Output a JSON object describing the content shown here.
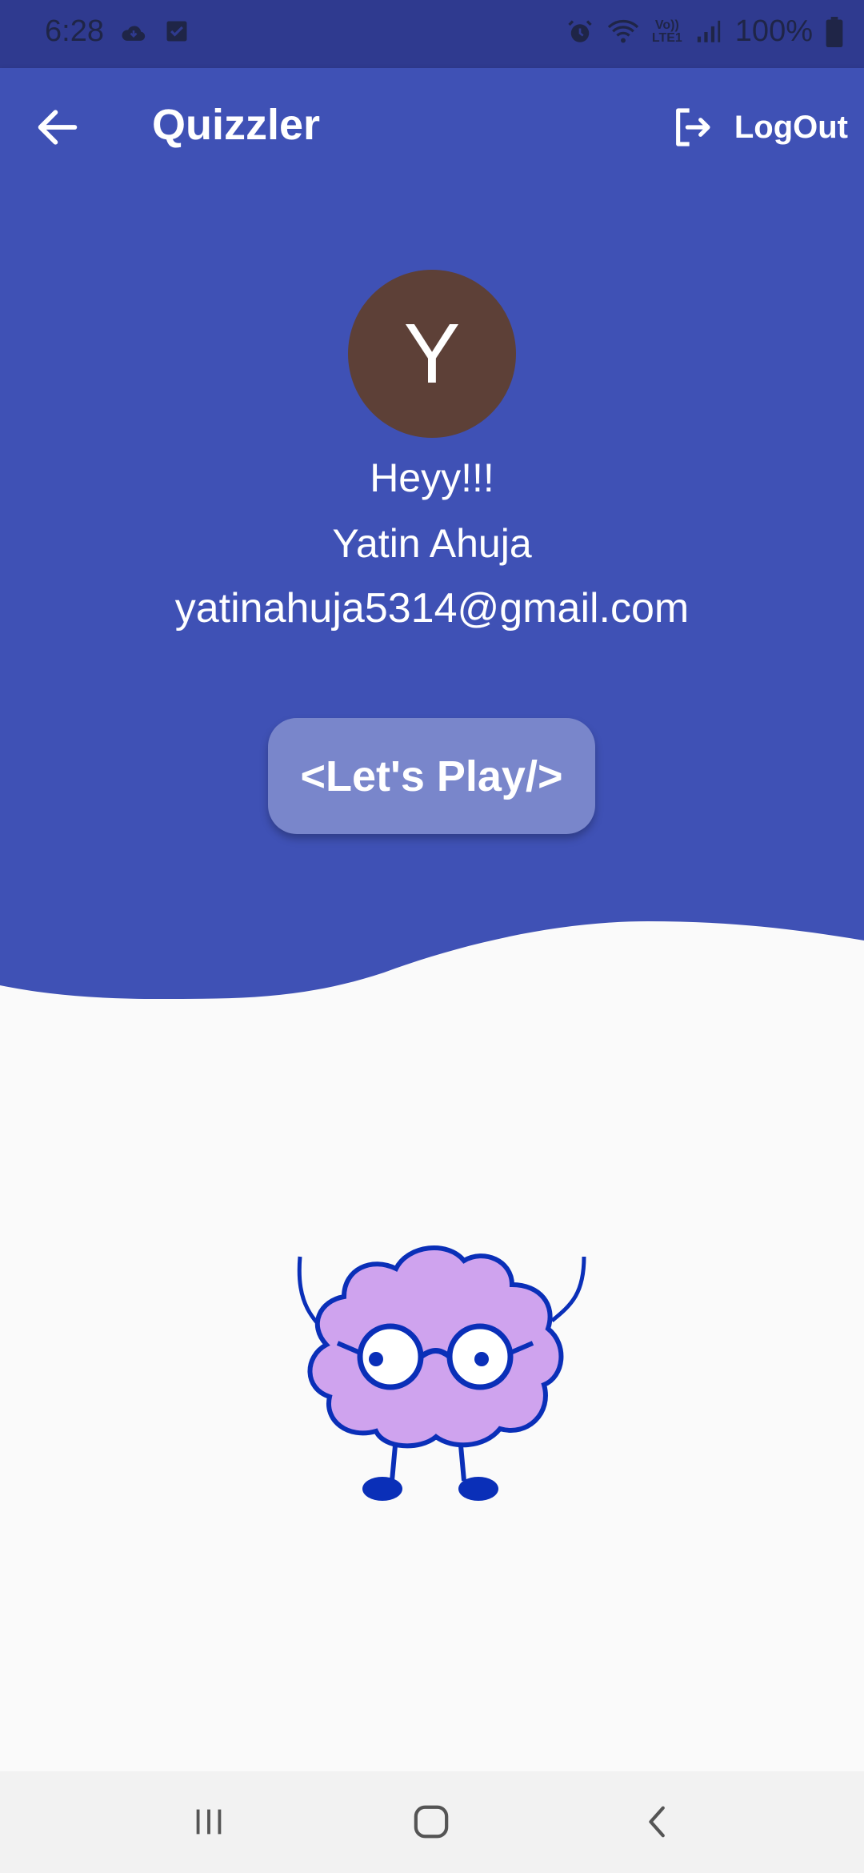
{
  "status_bar": {
    "time": "6:28",
    "battery_text": "100%",
    "icons": [
      "cloud-icon",
      "check-box-icon",
      "alarm-icon",
      "wifi-icon",
      "volte-icon",
      "signal-icon",
      "battery-icon"
    ],
    "volte_label_top": "Vo))",
    "volte_label_bottom": "LTE1"
  },
  "app_bar": {
    "title": "Quizzler",
    "back_icon": "arrow-back-icon",
    "logout_icon": "logout-icon",
    "logout_label": "LogOut"
  },
  "profile": {
    "avatar_initial": "Y",
    "greeting": "Heyy!!!",
    "name": "Yatin Ahuja",
    "email": "yatinahuja5314@gmail.com"
  },
  "play_button": {
    "label": "<Let's Play/>"
  },
  "mascot": {
    "icon": "brain-mascot-icon"
  },
  "nav_bar": {
    "icons": [
      "recents-icon",
      "home-icon",
      "back-icon"
    ]
  },
  "colors": {
    "primary": "#3f51b5",
    "status_bar": "#2f3a8f",
    "button": "#7986cb",
    "avatar": "#5d4037",
    "background": "#fafafa"
  }
}
